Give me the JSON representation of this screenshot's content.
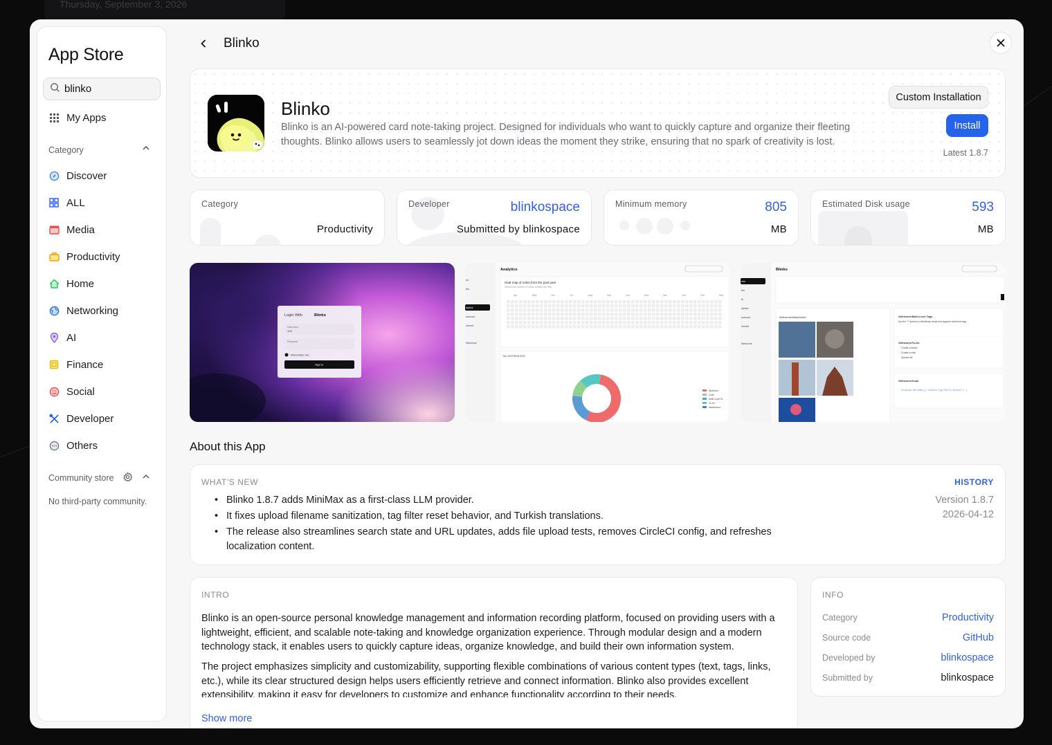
{
  "background": {
    "date": "Thursday, September 3, 2026"
  },
  "sidebar": {
    "title": "App Store",
    "search_value": "blinko",
    "my_apps": "My Apps",
    "category_label": "Category",
    "categories": [
      {
        "label": "Discover",
        "icon": "compass-icon",
        "color": "#3b82f6"
      },
      {
        "label": "ALL",
        "icon": "grid-icon",
        "color": "#3b6ff0"
      },
      {
        "label": "Media",
        "icon": "clapperboard-icon",
        "color": "#ef4444"
      },
      {
        "label": "Productivity",
        "icon": "briefcase-icon",
        "color": "#f59e0b"
      },
      {
        "label": "Home",
        "icon": "house-icon",
        "color": "#22c55e"
      },
      {
        "label": "Networking",
        "icon": "globe-icon",
        "color": "#2563eb"
      },
      {
        "label": "AI",
        "icon": "location-pin-icon",
        "color": "#8b5cf6"
      },
      {
        "label": "Finance",
        "icon": "banknote-icon",
        "color": "#eab308"
      },
      {
        "label": "Social",
        "icon": "smiley-icon",
        "color": "#ef4444"
      },
      {
        "label": "Developer",
        "icon": "tools-icon",
        "color": "#2563eb"
      },
      {
        "label": "Others",
        "icon": "ellipsis-circle-icon",
        "color": "#6b7280"
      }
    ],
    "community_label": "Community store",
    "no_community": "No third-party community."
  },
  "header": {
    "title": "Blinko"
  },
  "app": {
    "name": "Blinko",
    "description": "Blinko is an AI-powered card note-taking project. Designed for individuals who want to quickly capture and organize their fleeting thoughts. Blinko allows users to seamlessly jot down ideas the moment they strike, ensuring that no spark of creativity is lost.",
    "custom_install_label": "Custom Installation",
    "install_label": "Install",
    "latest": "Latest 1.8.7"
  },
  "stats": {
    "category": {
      "label": "Category",
      "value": "Productivity"
    },
    "developer": {
      "label": "Developer",
      "value": "blinkospace",
      "sub": "Submitted by blinkospace"
    },
    "memory": {
      "label": "Minimum memory",
      "value": "805",
      "unit": "MB"
    },
    "disk": {
      "label": "Estimated Disk usage",
      "value": "593",
      "unit": "MB"
    }
  },
  "screenshots": {
    "login": {
      "title": "Login With",
      "brand": "Blinko",
      "username_label": "Username",
      "username_value": "123",
      "password_label": "Password",
      "remember": "Remember me",
      "signin": "Sign in"
    },
    "analytics": {
      "title": "Analytics",
      "heatmap_title": "Heat map of notes from the past year",
      "heatmap_sub": "Shows the number of notes created per day",
      "months": [
        "Apr",
        "May",
        "Jun",
        "Jul",
        "Aug",
        "Sep",
        "Oct",
        "Nov",
        "Dec",
        "Jan",
        "Feb",
        "Mar"
      ],
      "tag_title": "TAG DISTRIBUTION",
      "legend": [
        "Welcome",
        "Code",
        "Multi-Level Ta",
        "To-Do",
        "Attachment"
      ],
      "nav": [
        "ko",
        "tes",
        "alytics",
        "sources",
        "chived",
        "Welcome"
      ]
    },
    "notes": {
      "title": "Blinko",
      "tag_attachment": "#Welcome/Attachment",
      "tag_multilevel": "#Welcome/Multi-Level Tags",
      "multilevel_text": "Use the \"/\" shortcut to effortlessly create and organize multi-level tags.",
      "tag_todo": "#Welcome/To-Do",
      "todos": [
        "Create a blinko",
        "Create a note",
        "Upload file"
      ],
      "tag_code": "#Welcome/Code",
      "code": "function Welcome(){ console.log(\"Hello Blinko\"); }",
      "nav": [
        "nko",
        "tes",
        "to",
        "alytics",
        "sources",
        "chived",
        "Welcome"
      ]
    }
  },
  "about": {
    "title": "About this App",
    "whats_new_label": "WHAT'S NEW",
    "history_label": "HISTORY",
    "items": [
      "Blinko 1.8.7 adds MiniMax as a first-class LLM provider.",
      "It fixes upload filename sanitization, tag filter reset behavior, and Turkish translations.",
      "The release also streamlines search state and URL updates, adds file upload tests, removes CircleCI config, and refreshes localization content."
    ],
    "version": "Version 1.8.7",
    "date": "2026-04-12"
  },
  "intro": {
    "label": "INTRO",
    "p1": "Blinko is an open-source personal knowledge management and information recording platform, focused on providing users with a lightweight, efficient, and scalable note-taking and knowledge organization experience. Through modular design and a modern technology stack, it enables users to quickly capture ideas, organize knowledge, and build their own information system.",
    "p2": "The project emphasizes simplicity and customizability, supporting flexible combinations of various content types (text, tags, links, etc.), while its clear structured design helps users efficiently retrieve and connect information. Blinko also provides excellent extensibility, making it easy for developers to customize and enhance functionality according to their needs.",
    "show_more": "Show more"
  },
  "info": {
    "label": "INFO",
    "rows": [
      {
        "key": "Category",
        "value": "Productivity"
      },
      {
        "key": "Source code",
        "value": "GitHub"
      },
      {
        "key": "Developed by",
        "value": "blinkospace"
      },
      {
        "key": "Submitted by",
        "value": "blinkospace"
      }
    ]
  },
  "colors": {
    "accent": "#2563eb",
    "link": "#2f5fe6"
  }
}
